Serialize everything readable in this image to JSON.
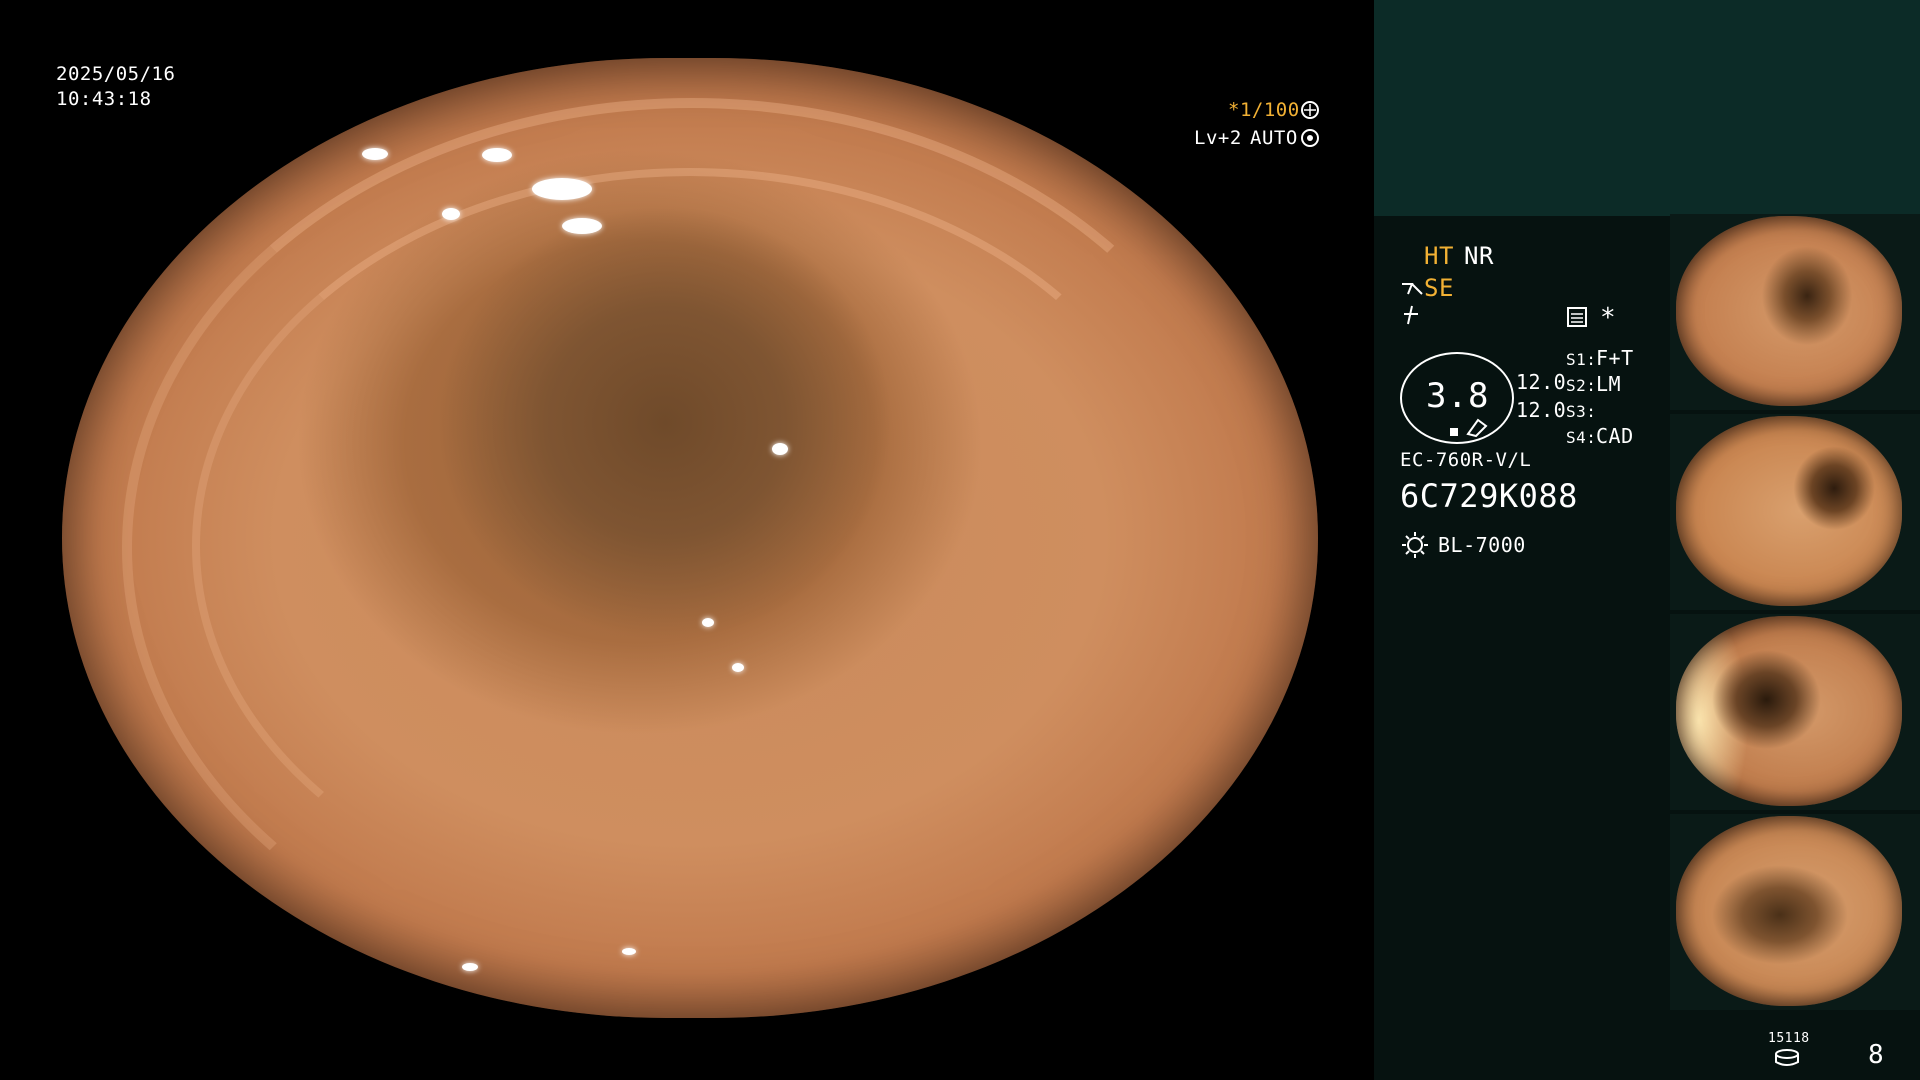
{
  "overlay": {
    "date": "2025/05/16",
    "time": "10:43:18",
    "shutter": "*1/100",
    "level": "Lv+2",
    "iris_mode": "AUTO"
  },
  "settings": {
    "ht": "HT",
    "nr": "NR",
    "se": "SE",
    "asterisk": "*",
    "magnification": "3.8",
    "value_1": "12.0",
    "value_2": "12.0",
    "s1_label": "S1:",
    "s1_value": "F+T",
    "s2_label": "S2:",
    "s2_value": "LM",
    "s3_label": "S3:",
    "s3_value": "",
    "s4_label": "S4:",
    "s4_value": "CAD",
    "scope_model": "EC-760R-V/L",
    "scope_serial": "6C729K088",
    "light_source": "BL-7000"
  },
  "storage": {
    "count_label": "15118",
    "page_number": "8"
  },
  "icons": [
    "shutter-icon",
    "iris-icon",
    "structure-enhance-icon",
    "flash-icon",
    "image-mode-icon",
    "light-source-icon",
    "scope-tip-icon",
    "storage-disk-icon"
  ],
  "thumbnails": [
    {
      "name": "thumbnail-1"
    },
    {
      "name": "thumbnail-2"
    },
    {
      "name": "thumbnail-3"
    },
    {
      "name": "thumbnail-4"
    }
  ],
  "colors": {
    "accent_yellow": "#f2b134",
    "panel_dark": "#061210",
    "panel_top": "#0c2b27",
    "mucosa": "#cf8e5f"
  }
}
